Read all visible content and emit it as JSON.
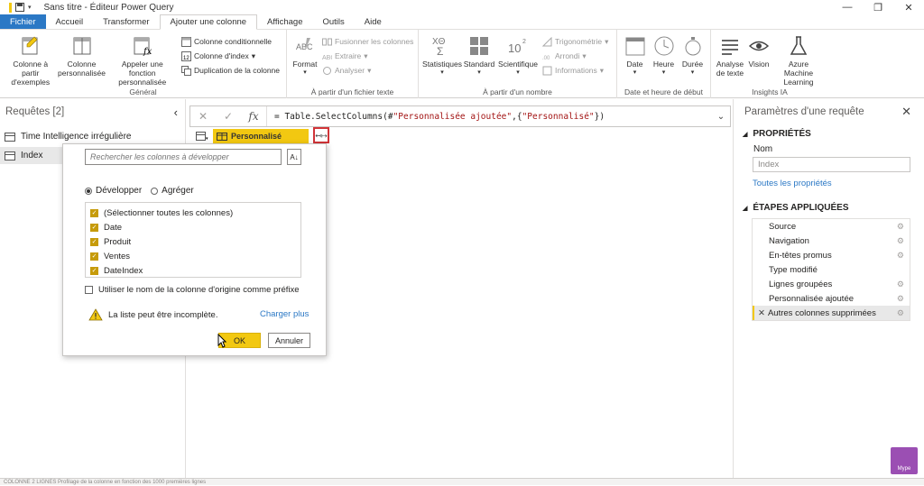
{
  "window": {
    "title": "Sans titre - Éditeur Power Query"
  },
  "tabs": [
    "Fichier",
    "Accueil",
    "Transformer",
    "Ajouter une colonne",
    "Affichage",
    "Outils",
    "Aide"
  ],
  "ribbon": {
    "general": {
      "label": "Général",
      "col_example": "Colonne à partir d'exemples",
      "custom_col": "Colonne personnalisée",
      "invoke_fn": "Appeler une fonction personnalisée",
      "conditional": "Colonne conditionnelle",
      "index": "Colonne d'index",
      "duplicate": "Duplication de la colonne"
    },
    "text": {
      "label": "À partir d'un fichier texte",
      "format": "Format",
      "merge": "Fusionner les colonnes",
      "extract": "Extraire",
      "parse": "Analyser"
    },
    "number": {
      "label": "À partir d'un nombre",
      "stats": "Statistiques",
      "standard": "Standard",
      "scientific": "Scientifique",
      "trig": "Trigonométrie",
      "round": "Arrondi",
      "info": "Informations"
    },
    "date": {
      "label": "Date et heure de début",
      "date": "Date",
      "hour": "Heure",
      "duration": "Durée"
    },
    "ai": {
      "label": "Insights IA",
      "text_analysis": "Analyse de texte",
      "vision": "Vision",
      "azure": "Azure Machine Learning"
    }
  },
  "queries": {
    "header": "Requêtes [2]",
    "items": [
      "Time Intelligence irrégulière",
      "Index"
    ]
  },
  "formula": {
    "prefix": "= Table.SelectColumns(#",
    "s1": "\"Personnalisée ajoutée\"",
    "mid": ",{",
    "s2": "\"Personnalisé\"",
    "suffix": "})"
  },
  "column": {
    "name": "Personnalisé"
  },
  "expand_dialog": {
    "search_placeholder": "Rechercher les colonnes à développer",
    "radio_expand": "Développer",
    "radio_aggregate": "Agréger",
    "columns": [
      "(Sélectionner toutes les colonnes)",
      "Date",
      "Produit",
      "Ventes",
      "DateIndex"
    ],
    "prefix_label": "Utiliser le nom de la colonne d'origine comme préfixe",
    "warning": "La liste peut être incomplète.",
    "load_more": "Charger plus",
    "ok": "OK",
    "cancel": "Annuler"
  },
  "settings": {
    "header": "Paramètres d'une requête",
    "properties": "PROPRIÉTÉS",
    "name_label": "Nom",
    "name_value": "Index",
    "all_props": "Toutes les propriétés",
    "applied_steps": "ÉTAPES APPLIQUÉES",
    "steps": [
      "Source",
      "Navigation",
      "En-têtes promus",
      "Type modifié",
      "Lignes groupées",
      "Personnalisée ajoutée",
      "Autres colonnes supprimées"
    ]
  },
  "status": {
    "text": "COLONNE 2 LIGNES    Profilage de la colonne en fonction des 1000 premières lignes"
  },
  "logo": {
    "text": "Mype"
  },
  "colors": {
    "accent": "#f2c811",
    "file_tab": "#2b78c5",
    "highlight_border": "#d13438"
  }
}
